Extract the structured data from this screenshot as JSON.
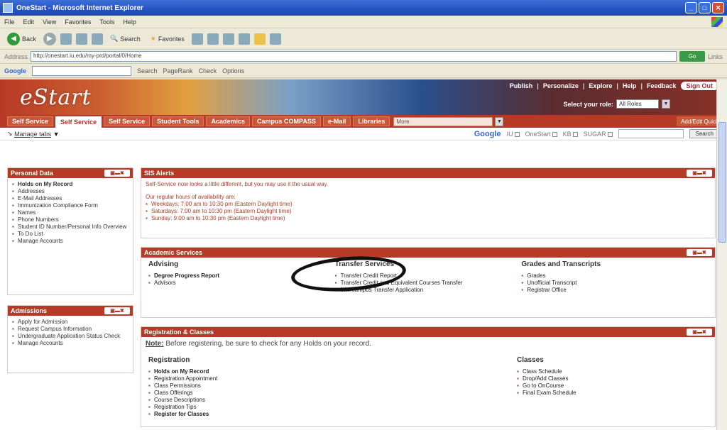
{
  "window": {
    "title": "OneStart - Microsoft Internet Explorer"
  },
  "menu": [
    "File",
    "Edit",
    "View",
    "Favorites",
    "Tools",
    "Help"
  ],
  "toolbar": {
    "back": "Back",
    "search": "Search",
    "favorites": "Favorites"
  },
  "address": {
    "label": "Address",
    "url": "http://onestart.iu.edu/my-prd/portal/0/Home",
    "go": "Go",
    "links": "Links"
  },
  "googlebar": {
    "logo": "Google",
    "search": "Search",
    "options": [
      "PageRank",
      "Check",
      "Options"
    ]
  },
  "banner": {
    "logo": "eStart",
    "links": [
      "Publish",
      "Personalize",
      "Explore",
      "Help",
      "Feedback"
    ],
    "signout": "Sign Out",
    "role_label": "Select your role:",
    "role_value": "All Roles"
  },
  "tabs": [
    "Self Service",
    "Self Service",
    "Self Service",
    "Student Tools",
    "Academics",
    "Campus COMPASS",
    "e-Mail",
    "Libraries",
    "More"
  ],
  "tab_right": "Add/Edit Quick",
  "util": {
    "add_tab": "Manage tabs",
    "google": "Google",
    "options": [
      "IU",
      "OneStart",
      "KB",
      "SUGAR"
    ],
    "search_btn": "Search"
  },
  "personal_data": {
    "title": "Personal Data",
    "items": [
      "Holds on My Record",
      "Addresses",
      "E-Mail Addresses",
      "Immunization Compliance Form",
      "Names",
      "Phone Numbers",
      "Student ID Number/Personal Info Overview",
      "To Do List",
      "Manage Accounts"
    ]
  },
  "admissions": {
    "title": "Admissions",
    "items": [
      "Apply for Admission",
      "Request Campus Information",
      "Undergraduate Application Status Check",
      "Manage Accounts"
    ]
  },
  "alerts": {
    "title": "SIS Alerts",
    "line1": "Self-Service now looks a little different, but you may use it the usual way.",
    "hours_intro": "Our regular hours of availability are:",
    "hours": [
      "Weekdays: 7:00 am to 10:30 pm (Eastern Daylight time)",
      "Saturdays: 7:00 am to 10:30 pm (Eastern Daylight time)",
      "Sunday: 9:00 am to 10:30 pm (Eastern Daylight time)"
    ]
  },
  "academic": {
    "title": "Academic Services",
    "advising": {
      "heading": "Advising",
      "items": [
        "Degree Progress Report",
        "Advisors"
      ]
    },
    "transfer": {
      "heading": "Transfer Services",
      "items": [
        "Transfer Credit Report",
        "Transfer Credit and Equivalent Courses Transfer",
        "Intercampus Transfer Application"
      ]
    },
    "grades": {
      "heading": "Grades and Transcripts",
      "items": [
        "Grades",
        "Unofficial Transcript",
        "Registrar Office"
      ]
    }
  },
  "registration": {
    "title": "Registration & Classes",
    "note_lead": "Note:",
    "note": "Before registering, be sure to check for any Holds on your record.",
    "registration": {
      "heading": "Registration",
      "items": [
        "Holds on My Record",
        "Registration Appointment",
        "Class Permissions",
        "Class Offerings",
        "Course Descriptions",
        "Registration Tips",
        "Register for Classes"
      ]
    },
    "classes": {
      "heading": "Classes",
      "items": [
        "Class Schedule",
        "Drop/Add Classes",
        "Go to OnCourse",
        "Final Exam Schedule"
      ]
    }
  },
  "ctrls": "▣▬✖"
}
